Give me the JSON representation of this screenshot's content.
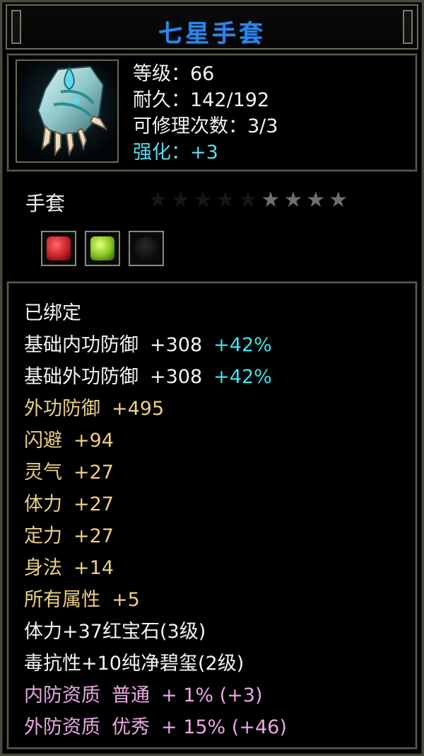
{
  "item": {
    "name": "七星手套",
    "level_label": "等级：66",
    "durability_label": "耐久：142/192",
    "repair_label": "可修理次数：3/3",
    "enhance_label": "强化：+3"
  },
  "type_label": "手套",
  "stars": {
    "total": 9,
    "lit": 4
  },
  "gems": [
    {
      "name": "red-gem-socket",
      "color": "#c8202a"
    },
    {
      "name": "green-gem-socket",
      "color": "#7fc21c"
    },
    {
      "name": "empty-socket",
      "color": "#1a1a1a"
    }
  ],
  "colors": {
    "title": "#2f86e6",
    "gold_attr": "#ebcf83",
    "pink_attr": "#e8a8e4",
    "cyan_bonus": "#40e0e8",
    "enhance": "#5fd8f0"
  },
  "properties": {
    "bound": "已绑定",
    "base_inner_def": {
      "label": "基础内功防御",
      "value": "+308",
      "bonus": "+42%"
    },
    "base_outer_def": {
      "label": "基础外功防御",
      "value": "+308",
      "bonus": "+42%"
    },
    "attrs": [
      {
        "label": "外功防御",
        "value": "+495"
      },
      {
        "label": "闪避",
        "value": "+94"
      },
      {
        "label": "灵气",
        "value": "+27"
      },
      {
        "label": "体力",
        "value": "+27"
      },
      {
        "label": "定力",
        "value": "+27"
      },
      {
        "label": "身法",
        "value": "+14"
      },
      {
        "label": "所有属性",
        "value": "+5"
      }
    ],
    "gem_line_1": "体力+37红宝石(3级)",
    "gem_line_2": "毒抗性+10纯净碧玺(2级)",
    "quality_1": {
      "label": "内防资质",
      "grade": "普通",
      "value": "+ 1% (+3)"
    },
    "quality_2": {
      "label": "外防资质",
      "grade": "优秀",
      "value": "+ 15% (+46)"
    }
  }
}
